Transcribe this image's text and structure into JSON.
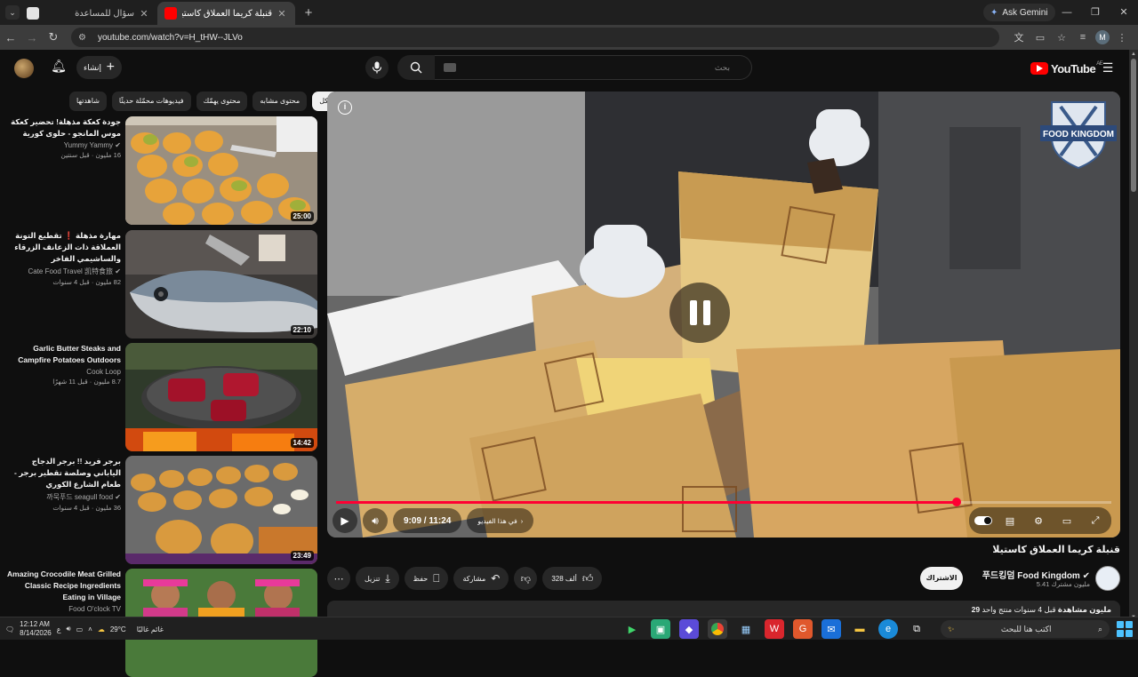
{
  "browser": {
    "tabs": [
      {
        "title": "سؤال للمساعدة",
        "active": false
      },
      {
        "title": "قنبلة كريما العملاق كاستيلا -",
        "active": true
      }
    ],
    "ask_gemini": "Ask Gemini",
    "url": "youtube.com/watch?v=H_tHW--JLVo",
    "profile_initial": "M"
  },
  "header": {
    "create_label": "إنشاء",
    "search_placeholder": "بحث",
    "logo_text": "YouTube",
    "logo_region": "AE"
  },
  "chips": [
    "شاهدتها",
    "فيديوهات محمّلة حديثًا",
    "محتوى يهمّك",
    "محتوى مشابه",
    "الكل"
  ],
  "recommendations": [
    {
      "title": "جودة كعكة مذهلة! تحضير كعكة موس المانجو - حلوى كورية",
      "channel": "Yummy Yammy",
      "verified": true,
      "stats": "16 مليون · قبل سنتين",
      "duration": "25:00"
    },
    {
      "title": "مهارة مذهلة ❗ تقطيع التونة العملاقة ذات الزعانف الزرقاء والساشيمي الفاخر",
      "channel": "Cate Food Travel 凯特食旅",
      "verified": true,
      "stats": "82 مليون · قبل 4 سنوات",
      "duration": "22:10"
    },
    {
      "title": "Garlic Butter Steaks and Campfire Potatoes Outdoors",
      "channel": "Cook Loop",
      "verified": false,
      "stats": "8.7 مليون · قبل 11 شهرًا",
      "duration": "14:42"
    },
    {
      "title": "برجر فريد !! برجر الدجاج الياباني وصلصة تقطير برجر - طعام الشارع الكوري",
      "channel": "까묵푸드 seagull food",
      "verified": true,
      "stats": "36 مليون · قبل 4 سنوات",
      "duration": "23:49"
    },
    {
      "title": "Amazing Crocodile Meat Grilled Classic Recipe Ingredients Eating in Village",
      "channel": "Food O'clock TV",
      "verified": false,
      "stats": "",
      "duration": ""
    }
  ],
  "player": {
    "watermark": "FOOD KINGDOM",
    "time": "9:09 / 11:24",
    "chapter": "في هذا الفيديو",
    "progress": 0.8
  },
  "video": {
    "title": "قنبلة كريما العملاق كاستيلا",
    "channel": "푸드킹덤 Food Kingdom",
    "subscribers": "5.41 مليون مشترك",
    "subscribe_label": "الاشتراك",
    "likes": "328 ألف",
    "share_label": "مشاركة",
    "save_label": "حفظ",
    "download_label": "تنزيل",
    "views": "29 مليون مشاهدة",
    "age": "قبل 4 سنوات",
    "extra": "منتج واحد"
  },
  "taskbar": {
    "time": "12:12 AM",
    "date": "8/14/2026",
    "weather": "29°C",
    "weather_label": "غائم غالبًا",
    "search_placeholder": "اكتب هنا للبحث",
    "lang": "ع"
  },
  "colors": {
    "accent": "#ff0033",
    "background": "#0f0f0f",
    "chip": "#272727"
  }
}
